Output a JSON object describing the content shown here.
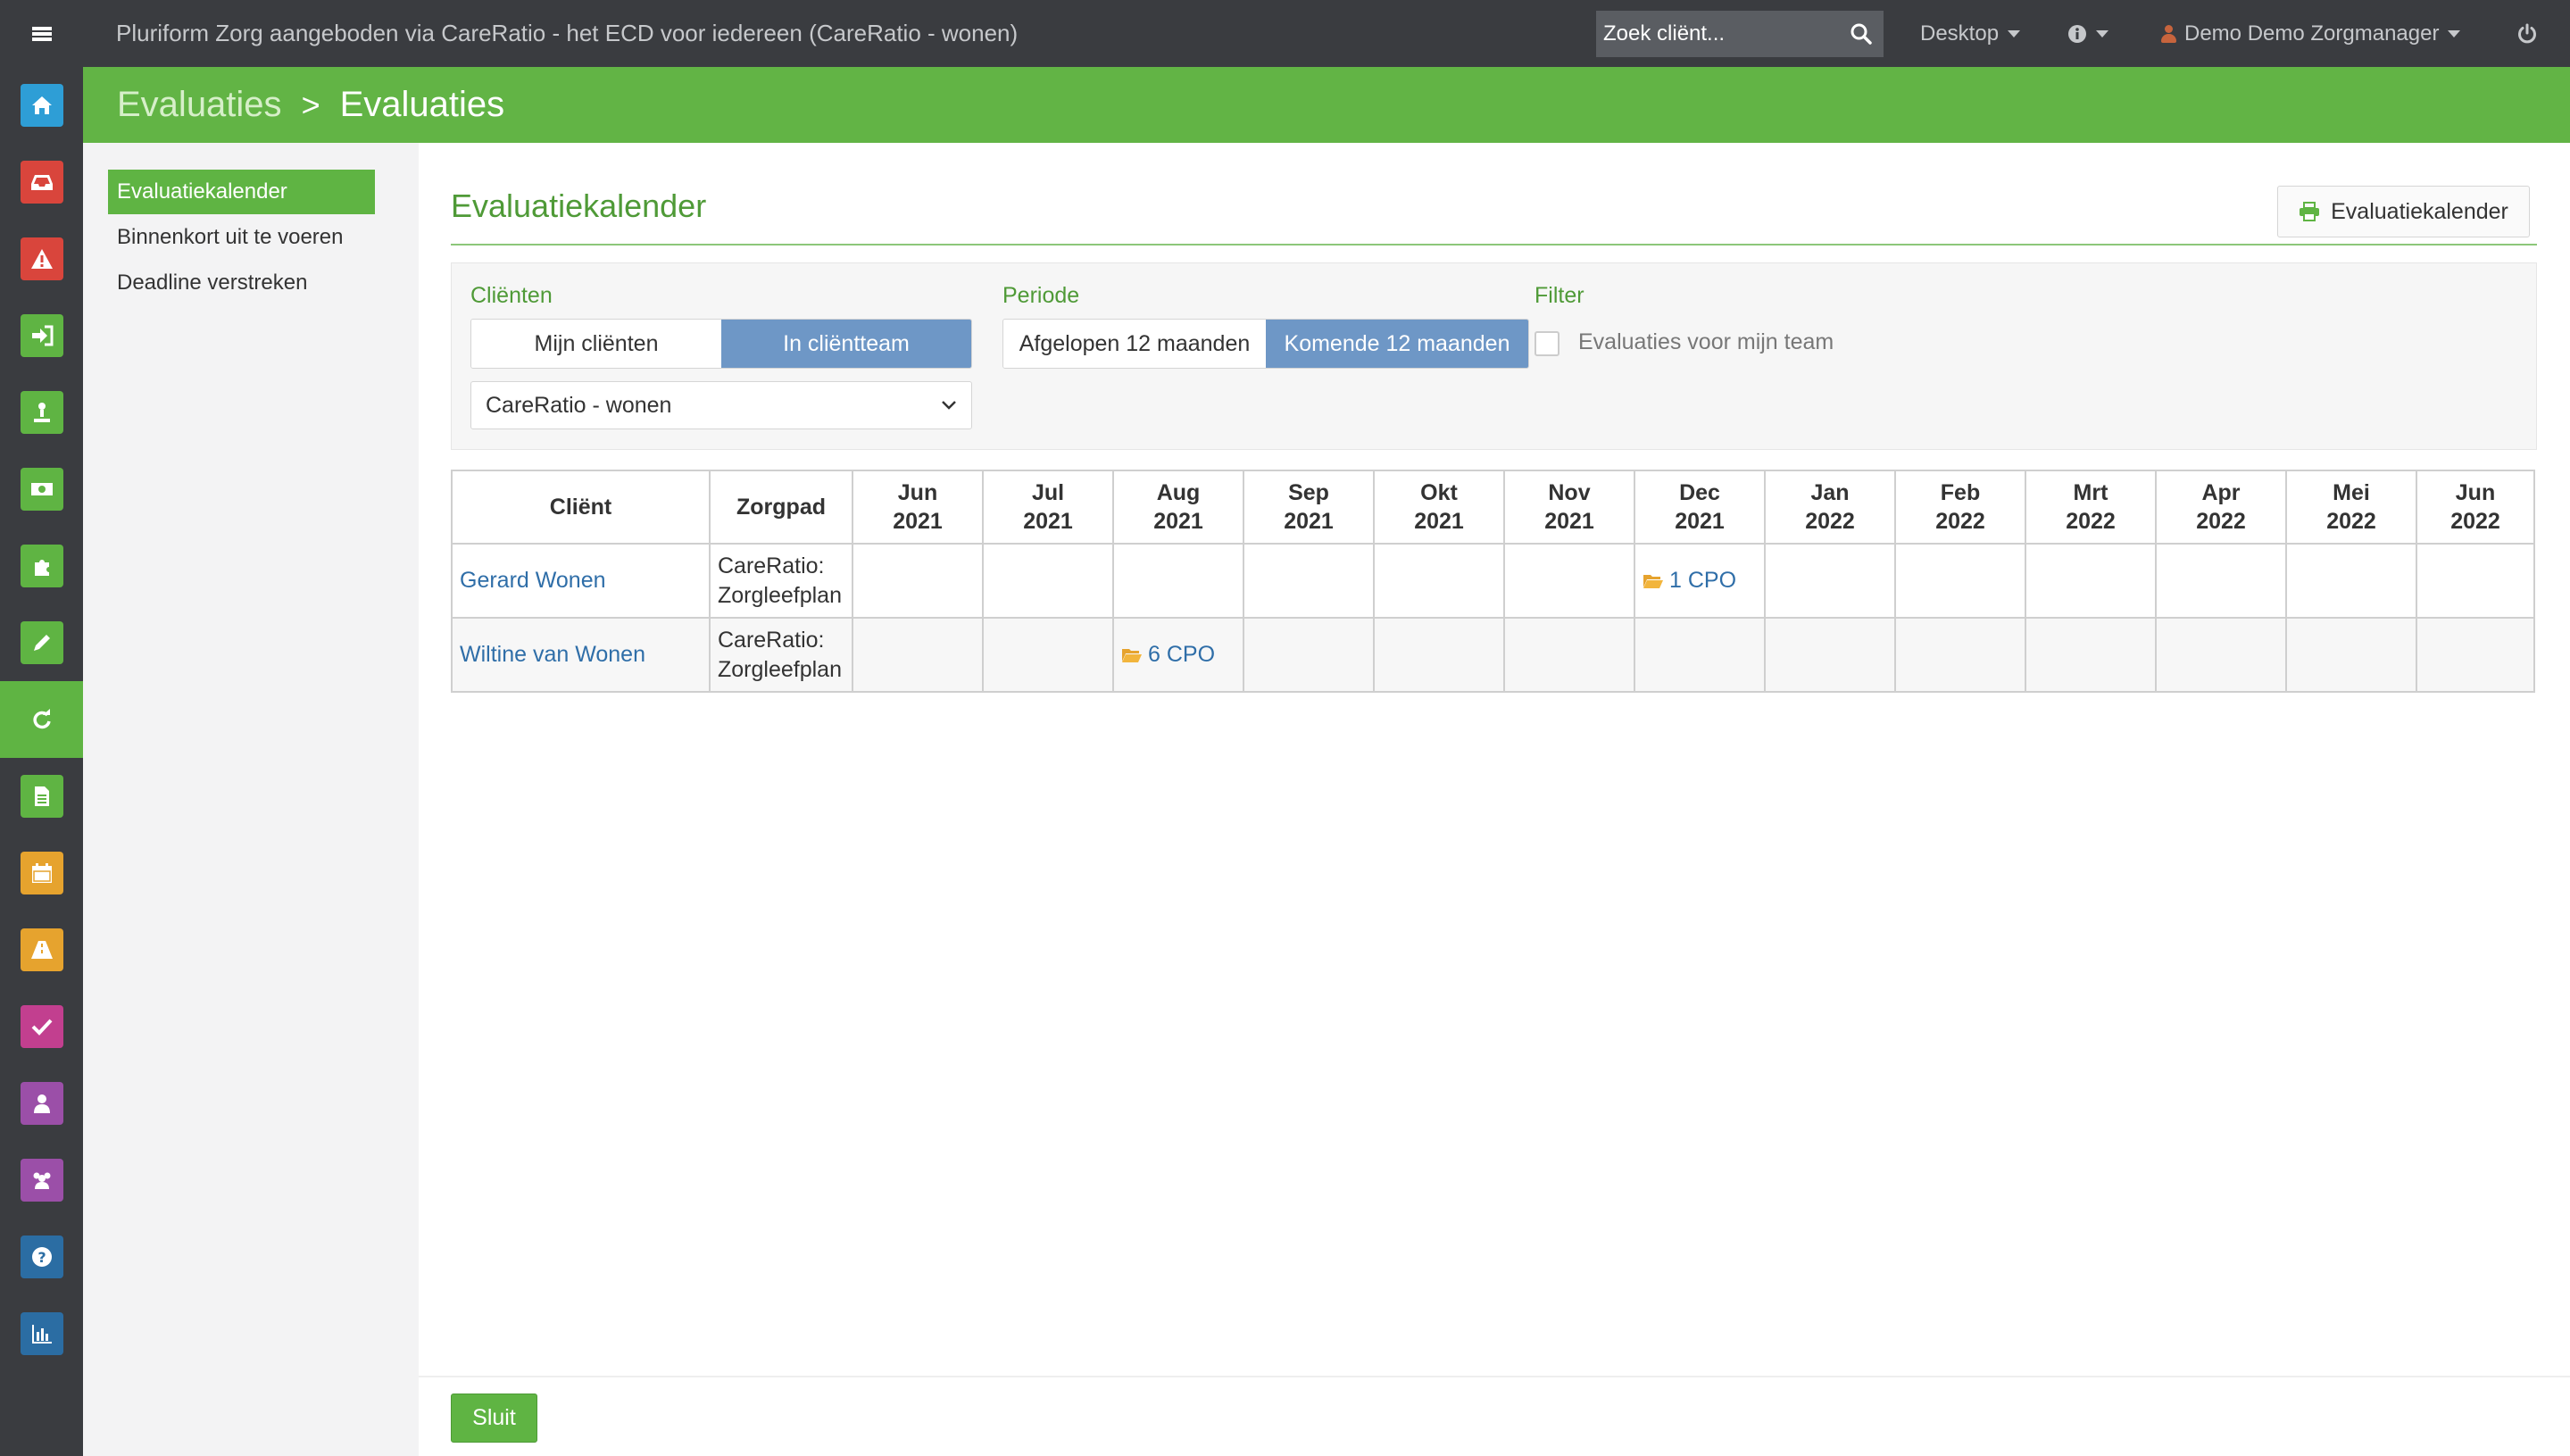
{
  "topbar": {
    "app_title": "Pluriform Zorg aangeboden via CareRatio - het ECD voor iedereen  (CareRatio - wonen)",
    "search_placeholder": "Zoek cliënt...",
    "desktop_label": "Desktop",
    "user_label": "Demo Demo Zorgmanager"
  },
  "iconbar": {
    "items": [
      {
        "icon": "home-icon",
        "color": "#2e9ed6"
      },
      {
        "icon": "inbox-icon",
        "color": "#d9453c"
      },
      {
        "icon": "warning-icon",
        "color": "#d9453c"
      },
      {
        "icon": "sign-in-icon",
        "color": "#5fb443"
      },
      {
        "icon": "user-upload-icon",
        "color": "#5fb443"
      },
      {
        "icon": "money-icon",
        "color": "#5fb443"
      },
      {
        "icon": "puzzle-icon",
        "color": "#5fb443"
      },
      {
        "icon": "pencil-icon",
        "color": "#5fb443"
      },
      {
        "icon": "refresh-icon",
        "color": "#5fb443",
        "active": true
      },
      {
        "icon": "document-icon",
        "color": "#5fb443"
      },
      {
        "icon": "calendar-icon",
        "color": "#e6a32e"
      },
      {
        "icon": "road-icon",
        "color": "#e6a32e"
      },
      {
        "icon": "check-icon",
        "color": "#c23f8f"
      },
      {
        "icon": "person-icon",
        "color": "#9b4fa8"
      },
      {
        "icon": "group-icon",
        "color": "#9b4fa8"
      },
      {
        "icon": "help-icon",
        "color": "#2b6da3"
      },
      {
        "icon": "bar-chart-icon",
        "color": "#2b6da3"
      }
    ]
  },
  "header": {
    "breadcrumb_root": "Evaluaties",
    "breadcrumb_separator": ">",
    "breadcrumb_current": "Evaluaties"
  },
  "leftnav": {
    "items": [
      {
        "label": "Evaluatiekalender",
        "active": true
      },
      {
        "label": "Binnenkort uit te voeren",
        "active": false
      },
      {
        "label": "Deadline verstreken",
        "active": false
      }
    ]
  },
  "main": {
    "title": "Evaluatiekalender",
    "print_button": "Evaluatiekalender",
    "filters": {
      "clients_label": "Cliënten",
      "clients_options": [
        "Mijn cliënten",
        "In cliëntteam"
      ],
      "clients_selected": "In cliëntteam",
      "location_select": "CareRatio - wonen",
      "period_label": "Periode",
      "period_options": [
        "Afgelopen 12 maanden",
        "Komende 12 maanden"
      ],
      "period_selected": "Komende 12 maanden",
      "filter_label": "Filter",
      "filter_checkbox": "Evaluaties voor mijn team",
      "filter_checked": false
    },
    "table": {
      "col_client": "Cliënt",
      "col_path": "Zorgpad",
      "months": [
        {
          "m": "Jun",
          "y": "2021"
        },
        {
          "m": "Jul",
          "y": "2021"
        },
        {
          "m": "Aug",
          "y": "2021"
        },
        {
          "m": "Sep",
          "y": "2021"
        },
        {
          "m": "Okt",
          "y": "2021"
        },
        {
          "m": "Nov",
          "y": "2021"
        },
        {
          "m": "Dec",
          "y": "2021"
        },
        {
          "m": "Jan",
          "y": "2022"
        },
        {
          "m": "Feb",
          "y": "2022"
        },
        {
          "m": "Mrt",
          "y": "2022"
        },
        {
          "m": "Apr",
          "y": "2022"
        },
        {
          "m": "Mei",
          "y": "2022"
        },
        {
          "m": "Jun",
          "y": "2022"
        }
      ],
      "rows": [
        {
          "client": "Gerard Wonen",
          "path_line1": "CareRatio:",
          "path_line2": "Zorgleefplan",
          "cells": [
            "",
            "",
            "",
            "",
            "",
            "",
            "1 CPO",
            "",
            "",
            "",
            "",
            "",
            ""
          ]
        },
        {
          "client": "Wiltine van Wonen",
          "path_line1": "CareRatio:",
          "path_line2": "Zorgleefplan",
          "cells": [
            "",
            "",
            "6 CPO",
            "",
            "",
            "",
            "",
            "",
            "",
            "",
            "",
            "",
            ""
          ]
        }
      ]
    },
    "close_button": "Sluit"
  },
  "colors": {
    "brand_green": "#62b445",
    "title_green": "#4f9a37",
    "segment_active": "#6e97c6",
    "link_blue": "#2f6ea8",
    "topbar_dark": "#3a3c40"
  }
}
